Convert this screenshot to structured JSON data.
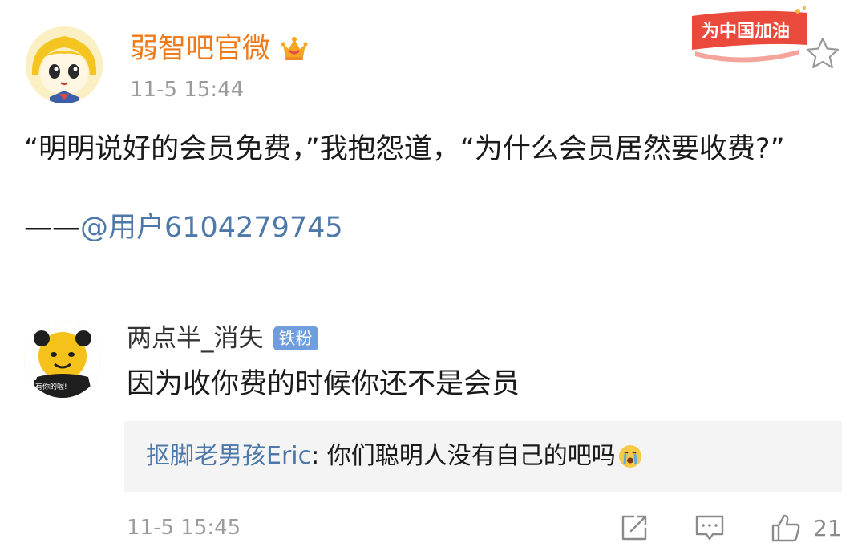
{
  "post": {
    "author": "弱智吧官微",
    "time": "11-5 15:44",
    "badge_text": "为中国加油",
    "text": "“明明说好的会员免费，”我抱怨道，“为什么会员居然要收费?”",
    "attribution_dash": "——",
    "attribution_user": "@用户6104279745"
  },
  "comment": {
    "author": "两点半_消失",
    "fan_badge": "铁粉",
    "avatar_caption": "有你的喔!",
    "text": "因为收你费的时候你还不是会员",
    "reply": {
      "user": "抠脚老男孩Eric",
      "separator": ": ",
      "text": "你们聪明人没有自己的吧吗"
    },
    "time": "11-5 15:45",
    "like_count": "21"
  },
  "icons": {
    "crown": "vip-crown-icon",
    "star": "star-outline-icon",
    "repost": "repost-icon",
    "comment": "comment-icon",
    "like": "thumbs-up-icon",
    "reply_emoji": "crying-face-icon"
  },
  "colors": {
    "author_orange": "#ef7a1a",
    "link_blue": "#4e78a8",
    "fan_badge_blue": "#6f9dde",
    "banner_red": "#e94a3c"
  }
}
